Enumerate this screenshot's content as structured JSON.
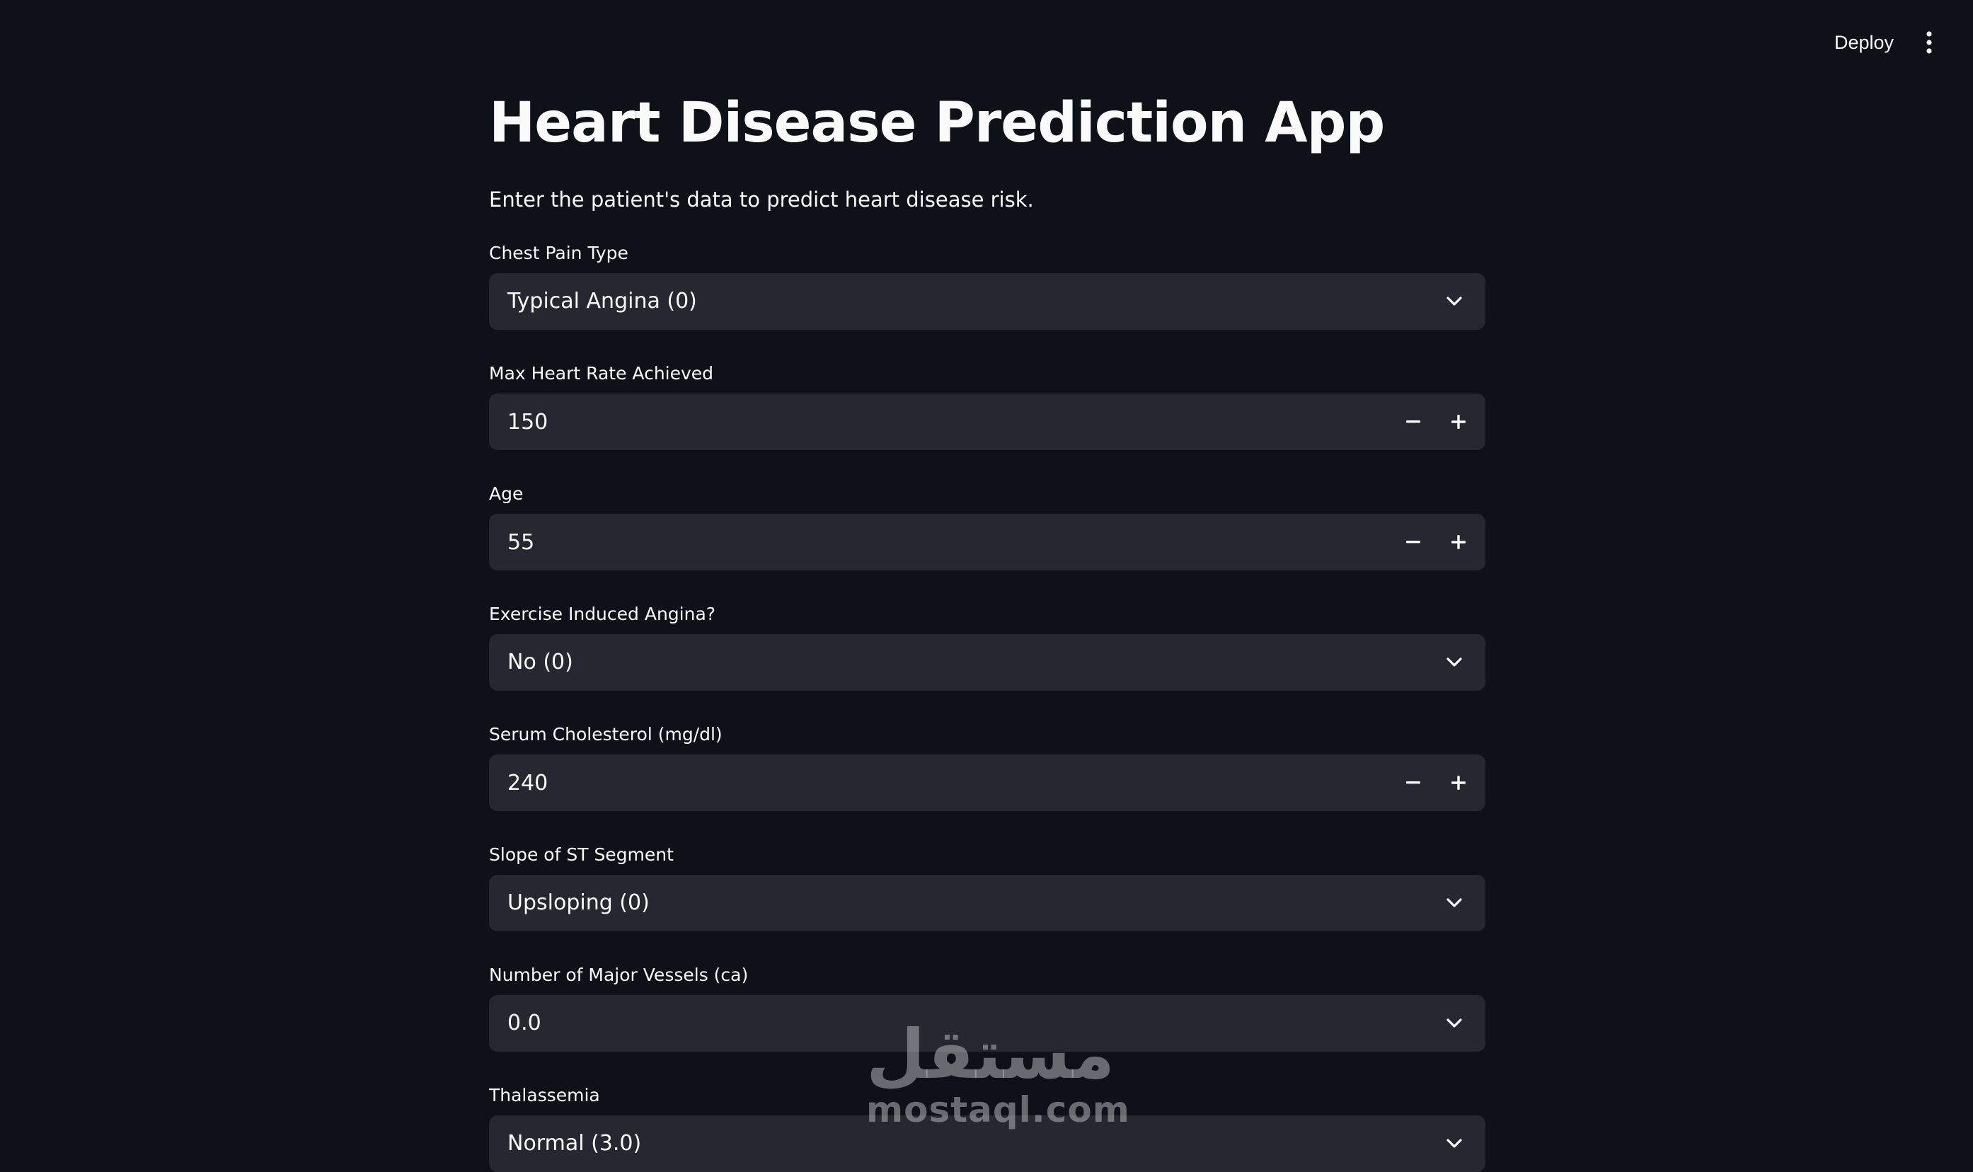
{
  "header": {
    "deploy_label": "Deploy",
    "menu_icon": "kebab-vertical-icon"
  },
  "main": {
    "title": "Heart Disease Prediction App",
    "subtitle": "Enter the patient's data to predict heart disease risk.",
    "fields": {
      "chest_pain": {
        "label": "Chest Pain Type",
        "value": "Typical Angina (0)"
      },
      "max_heart_rate": {
        "label": "Max Heart Rate Achieved",
        "value": "150"
      },
      "age": {
        "label": "Age",
        "value": "55"
      },
      "exercise_angina": {
        "label": "Exercise Induced Angina?",
        "value": "No (0)"
      },
      "cholesterol": {
        "label": "Serum Cholesterol (mg/dl)",
        "value": "240"
      },
      "slope": {
        "label": "Slope of ST Segment",
        "value": "Upsloping (0)"
      },
      "vessels": {
        "label": "Number of Major Vessels (ca)",
        "value": "0.0"
      },
      "thalassemia": {
        "label": "Thalassemia",
        "value": "Normal (3.0)"
      }
    }
  },
  "watermark": {
    "arabic": "مستقل",
    "latin": "mostaql.com"
  },
  "colors": {
    "background": "#0e1117",
    "control_background": "#262730",
    "text": "#fafafa"
  }
}
